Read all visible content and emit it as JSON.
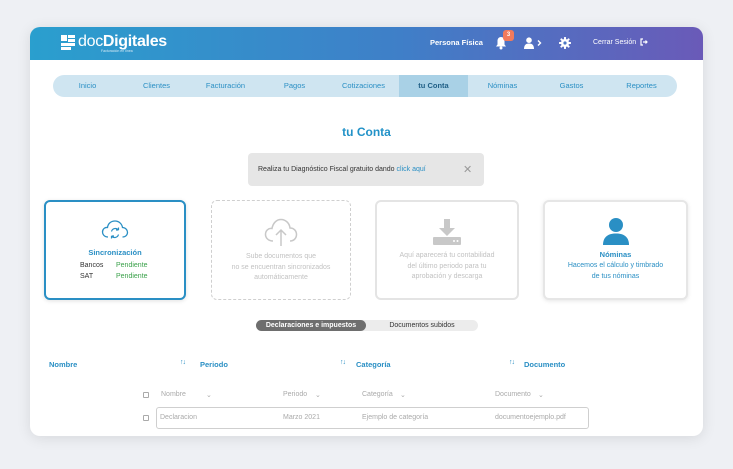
{
  "header": {
    "logo_light": "doc",
    "logo_bold": "Digitales",
    "logo_tagline": "Facturación en línea",
    "persona": "Persona Física",
    "notification_count": "3",
    "logout": "Cerrar Sesión"
  },
  "nav": {
    "items": [
      "Inicio",
      "Clientes",
      "Facturación",
      "Pagos",
      "Cotizaciones",
      "tu Conta",
      "Nóminas",
      "Gastos",
      "Reportes"
    ],
    "active": "tu Conta"
  },
  "page": {
    "title": "tu Conta"
  },
  "alert": {
    "text": "Realiza tu Diagnóstico Fiscal gratuito dando ",
    "link": "click aquí",
    "close": "✕"
  },
  "cards": {
    "sync": {
      "title": "Sincronización",
      "rows": [
        {
          "label": "Bancos",
          "status": "Pendiente"
        },
        {
          "label": "SAT",
          "status": "Pendiente"
        }
      ]
    },
    "upload": {
      "lines": [
        "Sube documentos que",
        "no se encuentran sincronizados",
        "automáticamente"
      ]
    },
    "download": {
      "lines": [
        "Aquí aparecerá tu contabilidad",
        "del último periodo para tu",
        "aprobación y descarga"
      ]
    },
    "nominas": {
      "title": "Nóminas",
      "lines": [
        "Hacemos el cálculo y timbrado",
        "de tus nóminas"
      ]
    }
  },
  "tabs": {
    "active": "Declaraciones e impuestos",
    "other": "Documentos subidos"
  },
  "table": {
    "headers": [
      "Nombre",
      "Periodo",
      "Categoría",
      "Documento"
    ],
    "sort_glyph": "↑↓",
    "sub_headers": [
      "Nombre",
      "Periodo",
      "Categoría",
      "Documento"
    ],
    "sub_caret": "⌄",
    "row": {
      "nombre": "Declaracion",
      "periodo": "Marzo 2021",
      "categoria": "Ejemplo de categoría",
      "documento": "documentoejemplo.pdf"
    }
  },
  "colors": {
    "accent": "#2a8fc4",
    "header_start": "#2a9fce",
    "header_end": "#6a5ab8",
    "status_ok": "#3aa14a",
    "badge": "#f27a5c"
  }
}
